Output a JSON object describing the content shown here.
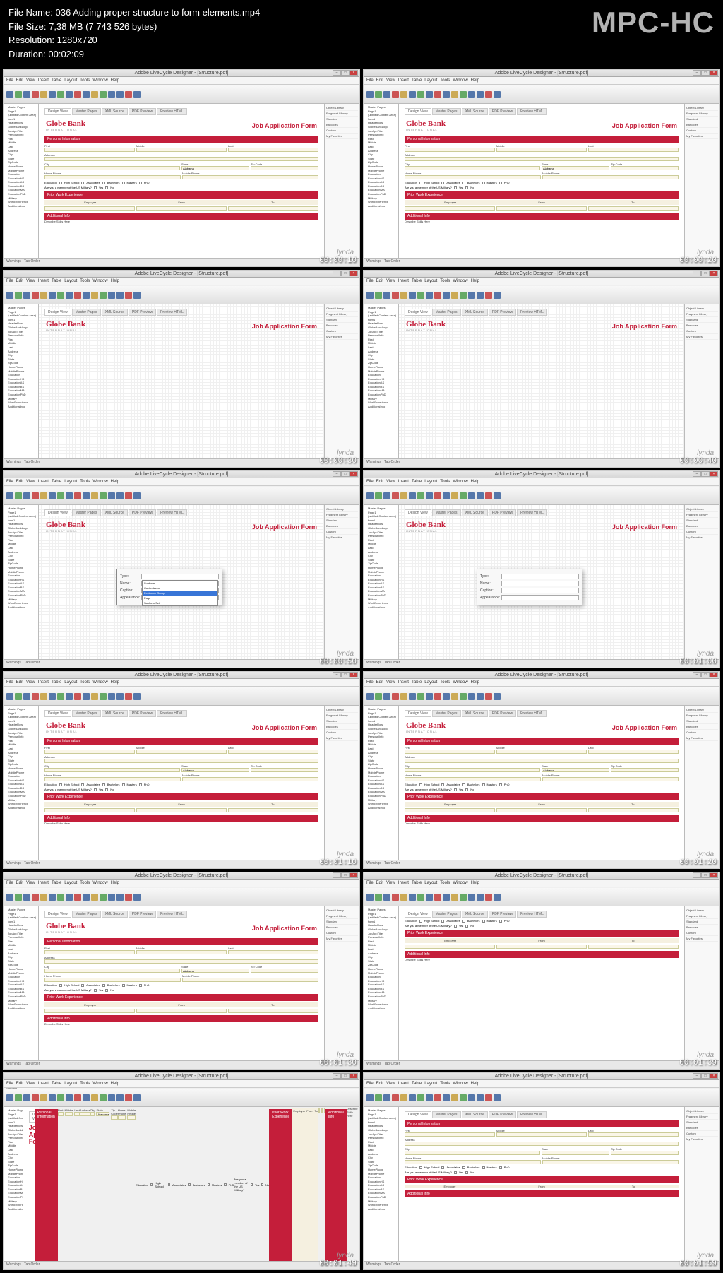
{
  "header": {
    "filename_label": "File Name:",
    "filename": "036 Adding proper structure to form elements.mp4",
    "filesize_label": "File Size:",
    "filesize": "7,38 MB (7 743 526 bytes)",
    "resolution_label": "Resolution:",
    "resolution": "1280x720",
    "duration_label": "Duration:",
    "duration": "00:02:09",
    "app_name": "MPC-HC"
  },
  "app_window_title": "Adobe LiveCycle Designer - [Structure.pdf]",
  "menu": [
    "File",
    "Edit",
    "View",
    "Insert",
    "Table",
    "Layout",
    "Tools",
    "Window",
    "Help"
  ],
  "tabs": [
    "Design View",
    "Master Pages",
    "XML Source",
    "PDF Preview",
    "Preview HTML"
  ],
  "form": {
    "logo": "Globe Bank",
    "logo_sub": "INTERNATIONAL",
    "title": "Job Application Form",
    "section1": "Personal Information",
    "fields": {
      "first": "First",
      "middle": "Middle",
      "last": "Last",
      "address": "Address",
      "city": "City",
      "state": "State",
      "state_val": "Alabama",
      "zip": "Zip Code",
      "home": "Home Phone",
      "mobile": "Mobile Phone",
      "education": "Education",
      "military": "Are you a member of the US Military?"
    },
    "edu_options": [
      "High School",
      "Associates",
      "Bachelors",
      "Masters",
      "PhD"
    ],
    "yn": [
      "Yes",
      "No"
    ],
    "section2": "Prior Work Experience",
    "work_cols": [
      "Employer",
      "From",
      "To"
    ],
    "section3": "Additional Info",
    "skills": "Describe Skills Here"
  },
  "hierarchy_items": [
    "Master Pages",
    "Page1",
    "(untitled Content Area)",
    "form1",
    "HeaderRow",
    "GlobeBankLogo",
    "JobAppTitle",
    "PersonalInfo",
    "First",
    "Middle",
    "Last",
    "Address",
    "City",
    "State",
    "ZipCode",
    "HomePhone",
    "MobilePhone",
    "Education",
    "EducationHS",
    "EducationAS",
    "EducationBS",
    "EducationMA",
    "EducationPhD",
    "Military",
    "WorkExperience",
    "AdditionalInfo"
  ],
  "props_panel": [
    "Object Library",
    "Fragment Library",
    "Standard",
    "Barcodes",
    "Custom",
    "My Favorites"
  ],
  "dialog": {
    "type_label": "Type:",
    "name_label": "Name:",
    "caption_label": "Caption:",
    "appearance_label": "Appearance:",
    "options": [
      "Subform",
      "ContentArea",
      "Exclusion Group",
      "Page",
      "Subform Set"
    ]
  },
  "timestamps": [
    "00:00:10",
    "00:00:20",
    "00:00:30",
    "00:00:40",
    "00:00:50",
    "00:01:00",
    "00:01:10",
    "00:01:20",
    "00:01:30",
    "00:01:39",
    "00:01:49",
    "00:01:59"
  ],
  "watermark": "lynda",
  "status": "Warnings",
  "status2": "Tab Order"
}
